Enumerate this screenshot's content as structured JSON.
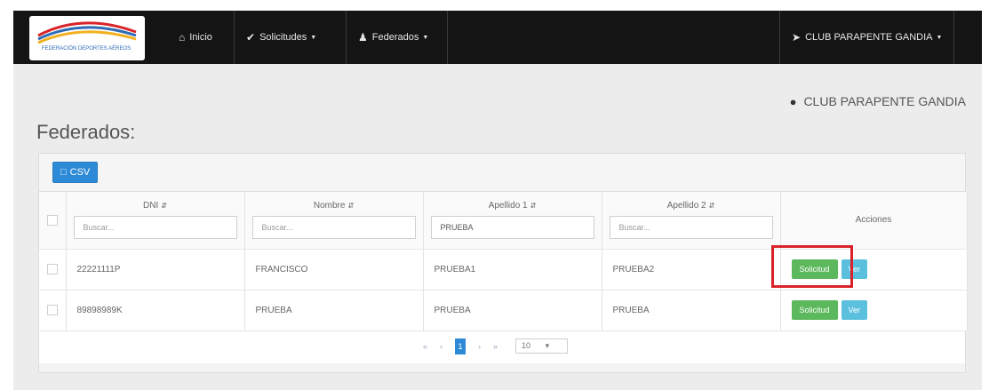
{
  "navbar": {
    "logo_text": "FEDERACIÓN DEPORTES AÉREOS",
    "items": [
      {
        "icon": "home-icon",
        "label": "Inicio",
        "dropdown": false
      },
      {
        "icon": "check-circle-icon",
        "label": "Solicitudes",
        "dropdown": true
      },
      {
        "icon": "users-icon",
        "label": "Federados",
        "dropdown": true
      }
    ],
    "club": {
      "icon": "send-icon",
      "label": "CLUB PARAPENTE GANDIA",
      "dropdown": true
    }
  },
  "user": {
    "icon": "user-icon",
    "name": "CLUB PARAPENTE GANDIA"
  },
  "page_title": "Federados:",
  "toolbar": {
    "csv_label": "CSV",
    "csv_icon": "file-icon"
  },
  "table": {
    "columns": [
      {
        "label": "DNI",
        "filter_value": "",
        "filter_placeholder": "Buscar..."
      },
      {
        "label": "Nombre",
        "filter_value": "",
        "filter_placeholder": "Buscar..."
      },
      {
        "label": "Apellido 1",
        "filter_value": "PRUEBA",
        "filter_placeholder": "Buscar..."
      },
      {
        "label": "Apellido 2",
        "filter_value": "",
        "filter_placeholder": "Buscar..."
      }
    ],
    "actions_header": "Acciones",
    "rows": [
      {
        "dni": "22221111P",
        "nombre": "FRANCISCO",
        "apellido1": "PRUEBA1",
        "apellido2": "PRUEBA2",
        "btn_solicitud": "Solicitud",
        "btn_ver": "Ver"
      },
      {
        "dni": "89898989K",
        "nombre": "PRUEBA",
        "apellido1": "PRUEBA",
        "apellido2": "PRUEBA",
        "btn_solicitud": "Solicitud",
        "btn_ver": "Ver"
      }
    ]
  },
  "pagination": {
    "first": "«",
    "prev": "‹",
    "current": "1",
    "next": "›",
    "last": "»",
    "page_size": "10"
  },
  "colors": {
    "navbar": "#141414",
    "primary": "#2d8ad6",
    "success": "#5cb85c",
    "info": "#5bc0de",
    "highlight": "#d9232a"
  }
}
